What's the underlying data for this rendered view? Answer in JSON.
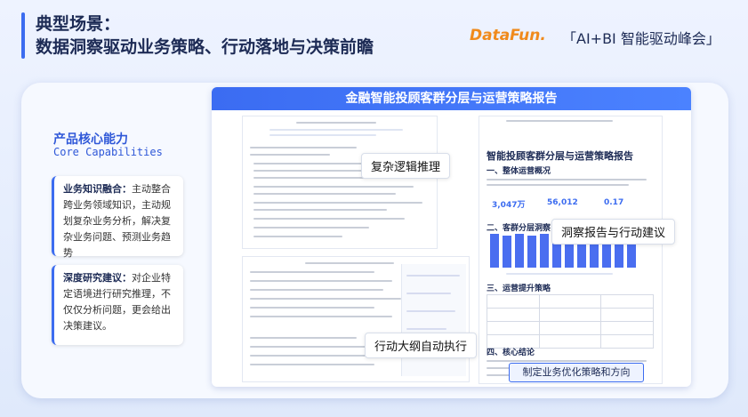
{
  "header": {
    "title_line1": "典型场景：",
    "title_line2": "数据洞察驱动业务策略、行动落地与决策前瞻",
    "brand_logo": "DataFun.",
    "brand_event": "「AI+BI 智能驱动峰会」",
    "accent_color": "#3c6cf0"
  },
  "core": {
    "title": "产品核心能力",
    "subtitle": "Core Capabilities",
    "cards": [
      {
        "heading": "业务知识融合：",
        "body": "主动整合跨业务领域知识，主动规划复杂业务分析，解决复杂业务问题、预测业务趋势"
      },
      {
        "heading": "深度研究建议：",
        "body": "对企业特定语境进行研究推理，不仅仅分析问题，更会给出决策建议。"
      }
    ]
  },
  "report": {
    "header": "金融智能投顾客群分层与运营策略报告",
    "labels": {
      "reasoning": "复杂逻辑推理",
      "insight": "洞察报告与行动建议",
      "execution": "行动大纲自动执行",
      "strategy": "制定业务优化策略和方向"
    },
    "doc": {
      "title": "智能投顾客群分层与运营策略报告",
      "section1": "一、整体运营概况",
      "section2": "二、客群分层洞察",
      "section3": "三、运营提升策略",
      "section4": "四、核心结论",
      "stats": [
        "3,047万",
        "56,012",
        "0.17"
      ]
    }
  }
}
